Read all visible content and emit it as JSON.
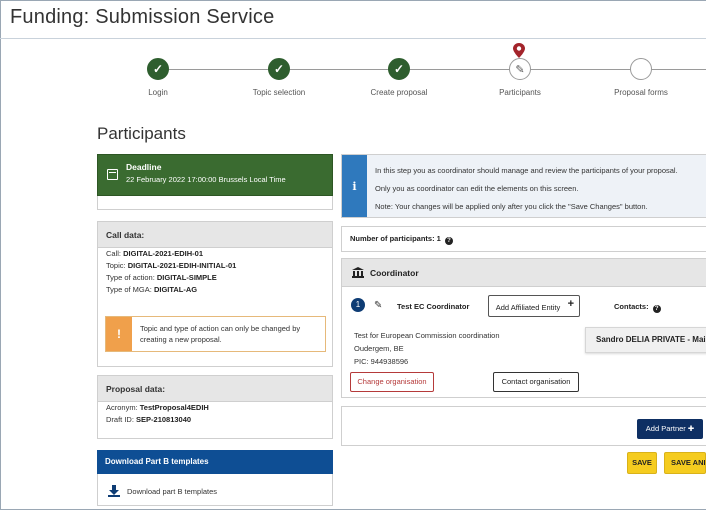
{
  "app": {
    "title": "Funding: Submission Service"
  },
  "stepper": {
    "steps": [
      {
        "label": "Login",
        "state": "done"
      },
      {
        "label": "Topic selection",
        "state": "done"
      },
      {
        "label": "Create proposal",
        "state": "done"
      },
      {
        "label": "Participants",
        "state": "active"
      },
      {
        "label": "Proposal forms",
        "state": "todo"
      }
    ]
  },
  "page": {
    "title": "Participants"
  },
  "deadline": {
    "label": "Deadline",
    "value": "22 February 2022 17:00:00 Brussels Local Time"
  },
  "call_data": {
    "heading": "Call data:",
    "call_label": "Call:",
    "call_value": "DIGITAL-2021-EDIH-01",
    "topic_label": "Topic:",
    "topic_value": "DIGITAL-2021-EDIH-INITIAL-01",
    "action_label": "Type of action:",
    "action_value": "DIGITAL-SIMPLE",
    "mga_label": "Type of MGA:",
    "mga_value": "DIGITAL-AG",
    "warning": "Topic and type of action can only be changed by creating a new proposal."
  },
  "proposal_data": {
    "heading": "Proposal data:",
    "acronym_label": "Acronym:",
    "acronym_value": "TestProposal4EDIH",
    "draft_label": "Draft ID:",
    "draft_value": "SEP-210813040"
  },
  "downloads": {
    "heading": "Download Part B templates",
    "link": "Download part B templates"
  },
  "info": {
    "line1": "In this step you as coordinator should manage and review the participants of your proposal.",
    "line2": "Only you as coordinator can edit the elements on this screen.",
    "line3": "Note: Your changes will be applied only after you click the \"Save Changes\" button."
  },
  "participants": {
    "count_label": "Number of participants: 1"
  },
  "coordinator": {
    "heading": "Coordinator",
    "index": "1",
    "name": "Test EC Coordinator",
    "add_affiliated": "Add Affiliated Entity",
    "contacts_label": "Contacts:",
    "org_name": "Test for European Commission coordination",
    "org_city": "Oudergem, BE",
    "pic": "PIC: 944938596",
    "contact_person": "Sandro DELIA PRIVATE - Mai",
    "change_org": "Change organisation",
    "contact_org": "Contact organisation"
  },
  "actions": {
    "add_partner": "Add Partner",
    "save": "SAVE",
    "save_and": "SAVE AND"
  },
  "colors": {
    "done_step": "#2e5e2e",
    "deadline_bg": "#3a6b30",
    "info_bar": "#2f79bd",
    "primary_navy": "#0e2f63",
    "warning": "#f0a04b",
    "save_yellow": "#f5cc1f",
    "danger_outline": "#b53a3a"
  }
}
